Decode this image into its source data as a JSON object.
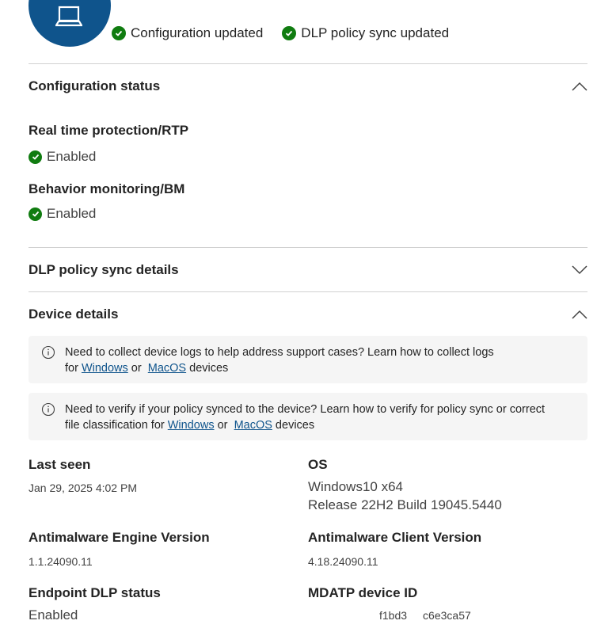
{
  "header": {
    "statuses": [
      "Configuration updated",
      "DLP policy sync updated"
    ]
  },
  "configuration_status": {
    "title": "Configuration status",
    "items": [
      {
        "label": "Real time protection/RTP",
        "value": "Enabled"
      },
      {
        "label": "Behavior monitoring/BM",
        "value": "Enabled"
      }
    ]
  },
  "dlp_sync": {
    "title": "DLP policy sync details"
  },
  "device_details": {
    "title": "Device details",
    "info1": {
      "text": "Need to collect device logs to help address support cases? Learn how to collect logs",
      "prefix": "for ",
      "link1": "Windows",
      "or": " or ",
      "link2": "MacOS",
      "suffix": " devices"
    },
    "info2": {
      "text": "Need to verify if your policy synced to the device? Learn how to verify for policy sync or correct",
      "prefix": "file classification for ",
      "link1": "Windows",
      "or": " or ",
      "link2": "MacOS",
      "suffix": " devices"
    },
    "fields": {
      "last_seen": {
        "label": "Last seen",
        "value": "Jan 29, 2025 4:02 PM"
      },
      "os": {
        "label": "OS",
        "value1": "Windows10 x64",
        "value2": "Release 22H2 Build 19045.5440"
      },
      "engine": {
        "label": "Antimalware Engine Version",
        "value": "1.1.24090.11"
      },
      "client": {
        "label": "Antimalware Client Version",
        "value": "4.18.24090.11"
      },
      "dlp_status": {
        "label": "Endpoint DLP status",
        "value": "Enabled"
      },
      "mdatp": {
        "label": "MDATP device ID",
        "frag1": "f1bd3",
        "frag2": "c6e3ca57"
      }
    }
  }
}
